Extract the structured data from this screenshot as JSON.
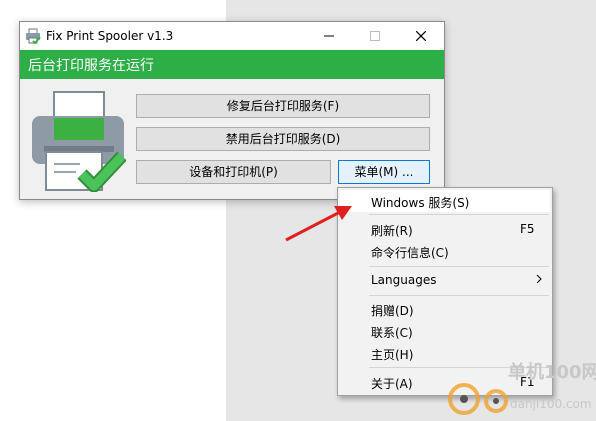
{
  "window": {
    "title": "Fix Print Spooler v1.3",
    "status": "后台打印服务在运行"
  },
  "buttons": {
    "repair": "修复后台打印服务(F)",
    "disable": "禁用后台打印服务(D)",
    "devices": "设备和打印机(P)",
    "menu": "菜单(M) ..."
  },
  "menu": {
    "items": [
      {
        "label": "Windows 服务(S)",
        "shortcut": ""
      },
      {
        "label": "刷新(R)",
        "shortcut": "F5"
      },
      {
        "label": "命令行信息(C)",
        "shortcut": ""
      },
      {
        "label": "Languages",
        "shortcut": ""
      },
      {
        "label": "捐赠(D)",
        "shortcut": ""
      },
      {
        "label": "联系(C)",
        "shortcut": ""
      },
      {
        "label": "主页(H)",
        "shortcut": ""
      },
      {
        "label": "关于(A)",
        "shortcut": "F1"
      }
    ]
  },
  "watermark": {
    "line1": "单机100网",
    "line2": "danji100.com"
  },
  "colors": {
    "status_green": "#2eae47",
    "arrow_red": "#e02020",
    "check_green": "#3cb043"
  }
}
